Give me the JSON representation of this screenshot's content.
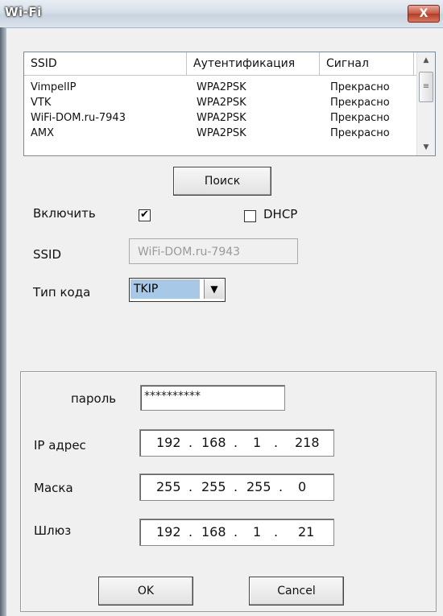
{
  "window": {
    "title": "Wi-Fi",
    "close_label": "X"
  },
  "network_list": {
    "columns": [
      "SSID",
      "Аутентификация",
      "Сигнал"
    ],
    "rows": [
      {
        "ssid": "VimpelIP",
        "auth": "WPA2PSK",
        "signal": "Прекрасно"
      },
      {
        "ssid": "VTK",
        "auth": "WPA2PSK",
        "signal": "Прекрасно"
      },
      {
        "ssid": "WiFi-DOM.ru-7943",
        "auth": "WPA2PSK",
        "signal": "Прекрасно"
      },
      {
        "ssid": "AMX",
        "auth": "WPA2PSK",
        "signal": "Прекрасно"
      }
    ]
  },
  "search_button": "Поиск",
  "enable": {
    "label": "Включить",
    "checked": true
  },
  "dhcp": {
    "label": "DHCP",
    "checked": false
  },
  "ssid": {
    "label": "SSID",
    "value": "WiFi-DOM.ru-7943"
  },
  "encryption": {
    "label": "Тип кода",
    "value": "TKIP"
  },
  "password": {
    "label": "пароль",
    "value": "**********"
  },
  "ip": {
    "label": "IP адрес",
    "octets": [
      "192",
      "168",
      "1",
      "218"
    ]
  },
  "mask": {
    "label": "Маска",
    "octets": [
      "255",
      "255",
      "255",
      "0"
    ]
  },
  "gateway": {
    "label": "Шлюз",
    "octets": [
      "192",
      "168",
      "1",
      "21"
    ]
  },
  "ok_button": "OK",
  "cancel_button": "Cancel"
}
